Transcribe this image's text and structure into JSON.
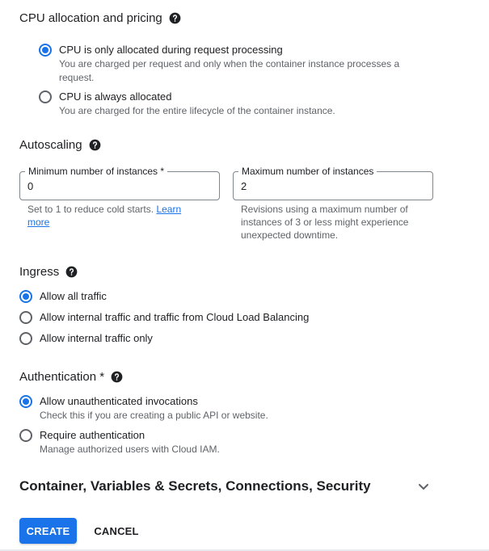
{
  "cpu": {
    "title": "CPU allocation and pricing",
    "options": [
      {
        "label": "CPU is only allocated during request processing",
        "desc": "You are charged per request and only when the container instance processes a request.",
        "checked": true
      },
      {
        "label": "CPU is always allocated",
        "desc": "You are charged for the entire lifecycle of the container instance.",
        "checked": false
      }
    ]
  },
  "autoscaling": {
    "title": "Autoscaling",
    "min": {
      "label": "Minimum number of instances *",
      "value": "0",
      "hint_text": "Set to 1 to reduce cold starts.",
      "hint_link": "Learn more"
    },
    "max": {
      "label": "Maximum number of instances",
      "value": "2",
      "hint_text": "Revisions using a maximum number of instances of 3 or less might experience unexpected downtime."
    }
  },
  "ingress": {
    "title": "Ingress",
    "options": [
      {
        "label": "Allow all traffic",
        "checked": true
      },
      {
        "label": "Allow internal traffic and traffic from Cloud Load Balancing",
        "checked": false
      },
      {
        "label": "Allow internal traffic only",
        "checked": false
      }
    ]
  },
  "authentication": {
    "title": "Authentication *",
    "options": [
      {
        "label": "Allow unauthenticated invocations",
        "desc": "Check this if you are creating a public API or website.",
        "checked": true
      },
      {
        "label": "Require authentication",
        "desc": "Manage authorized users with Cloud IAM.",
        "checked": false
      }
    ]
  },
  "expander": {
    "title": "Container, Variables & Secrets, Connections, Security",
    "icon": "chevron-down-icon"
  },
  "actions": {
    "create": "CREATE",
    "cancel": "CANCEL"
  },
  "colors": {
    "accent": "#1a73e8",
    "text": "#202124",
    "muted": "#5f6368"
  }
}
